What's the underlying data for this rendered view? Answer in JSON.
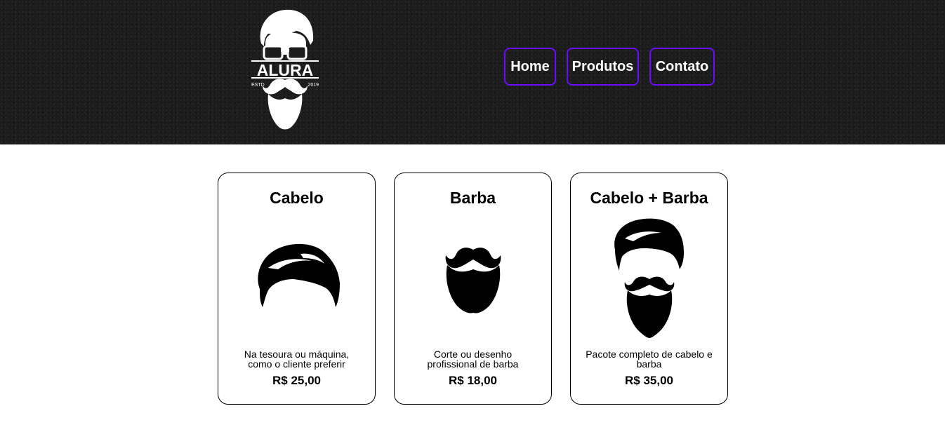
{
  "header": {
    "logo": {
      "text": "ALURA",
      "estd": "ESTD",
      "year": "2019",
      "icon": "bearded-man-logo"
    },
    "nav": [
      {
        "label": "Home"
      },
      {
        "label": "Produtos"
      },
      {
        "label": "Contato"
      }
    ],
    "accent_color": "#6a0dff"
  },
  "products": [
    {
      "title": "Cabelo",
      "description": "Na tesoura ou máquina, como o cliente preferir",
      "price": "R$ 25,00",
      "icon": "hair-icon"
    },
    {
      "title": "Barba",
      "description": "Corte ou desenho profissional de barba",
      "price": "R$ 18,00",
      "icon": "beard-icon"
    },
    {
      "title": "Cabelo + Barba",
      "description": "Pacote completo de cabelo e barba",
      "price": "R$ 35,00",
      "icon": "hair-and-beard-icon"
    }
  ]
}
